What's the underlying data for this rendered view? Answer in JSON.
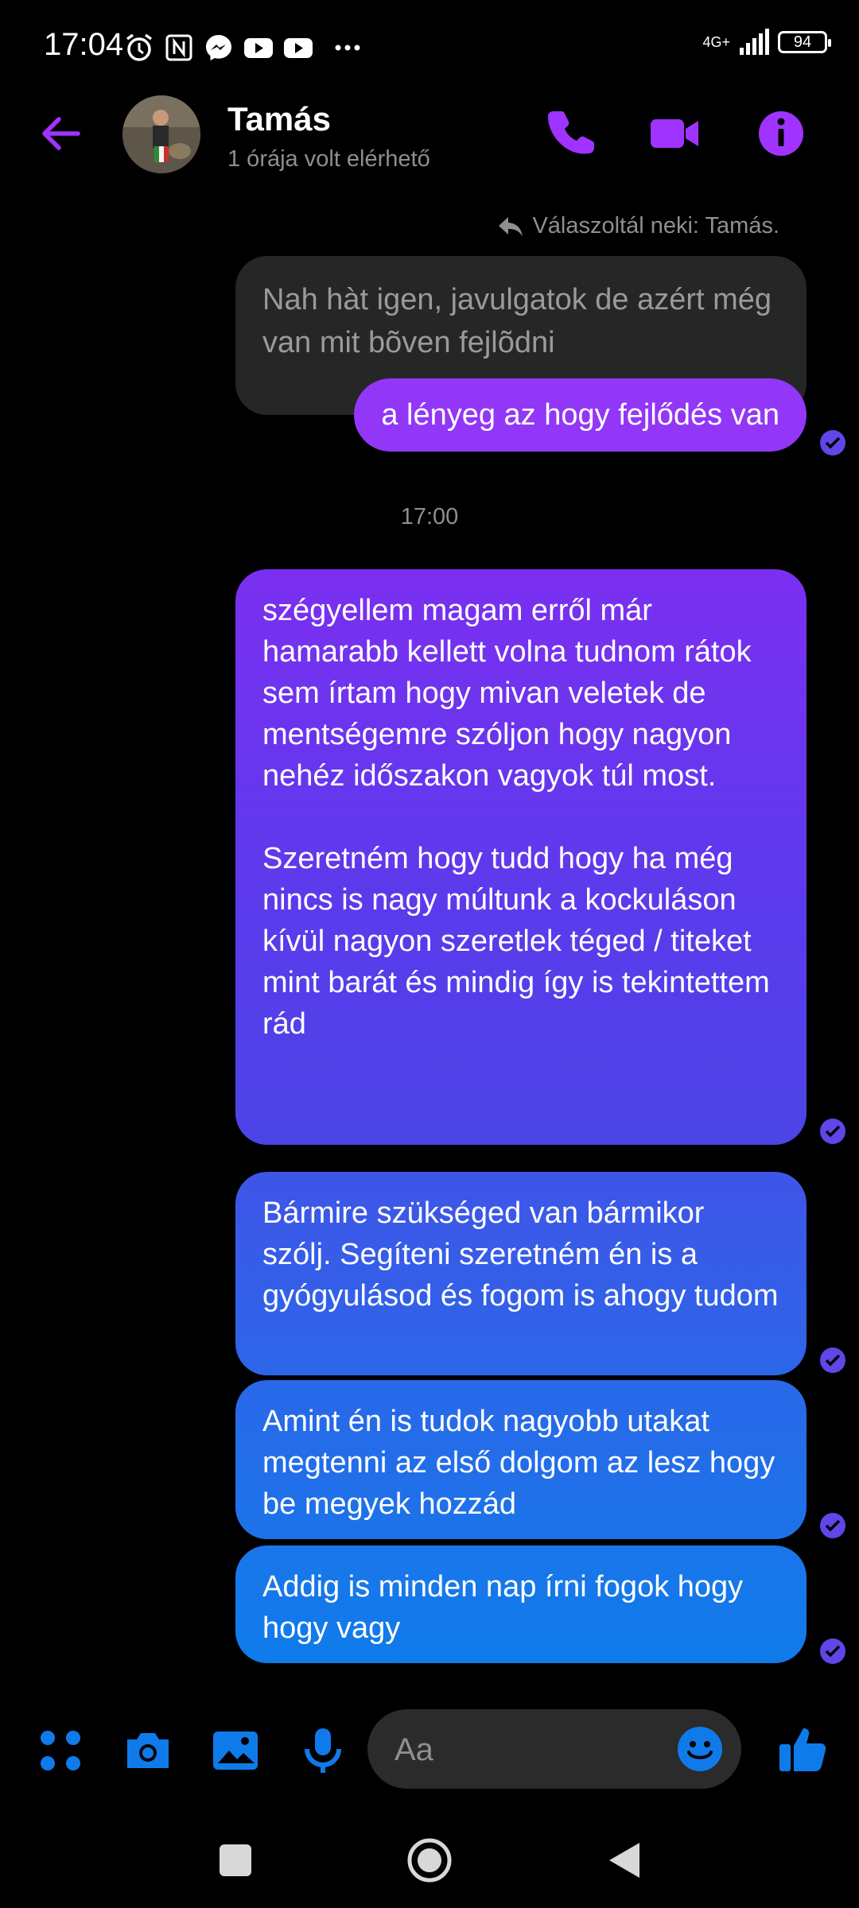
{
  "status_bar": {
    "time": "17:04",
    "network": "4G+",
    "battery": "94",
    "icons": [
      "alarm-icon",
      "nfc-icon",
      "messenger-icon",
      "youtube-icon",
      "youtube-icon",
      "more-dots-icon",
      "signal-icon"
    ]
  },
  "header": {
    "contact_name": "Tamás",
    "contact_status": "1 órája volt elérhető",
    "icons": [
      "back-arrow-icon",
      "phone-icon",
      "video-camera-icon",
      "info-icon"
    ]
  },
  "chat": {
    "reply_note": "Válaszoltál neki: Tamás.",
    "quoted_message": "Nah hàt igen, javulgatok de azért még van mit bõven fejlõdni",
    "reply_message": "a lényeg az hogy fejlődés van",
    "timestamp": "17:00",
    "messages": [
      "szégyellem magam erről már hamarabb kellett volna tudnom rátok sem írtam hogy mivan veletek de mentségemre szóljon hogy nagyon nehéz időszakon vagyok túl most.\n\nSzeretném hogy tudd hogy ha még nincs is nagy múltunk a kockuláson kívül nagyon szeretlek téged / titeket mint barát és mindig így is tekintettem rád",
      "Bármire szükséged van bármikor szólj. Segíteni szeretném én is a gyógyulásod és fogom is ahogy tudom",
      "Amint én is tudok nagyobb utakat megtenni az első dolgom az lesz hogy be megyek hozzád",
      "Addig is minden nap írni fogok hogy hogy vagy"
    ]
  },
  "composer": {
    "placeholder": "Aa",
    "icons": [
      "apps-grid-icon",
      "camera-icon",
      "gallery-icon",
      "microphone-icon",
      "emoji-icon",
      "thumbs-up-icon"
    ]
  },
  "nav": {
    "icons": [
      "recent-apps-icon",
      "home-icon",
      "back-icon"
    ]
  },
  "colors": {
    "accent": "#a033ff",
    "bubble_top": "#7b2ff0",
    "bubble_bottom": "#0f7bea",
    "seen_check": "#6046e8"
  }
}
